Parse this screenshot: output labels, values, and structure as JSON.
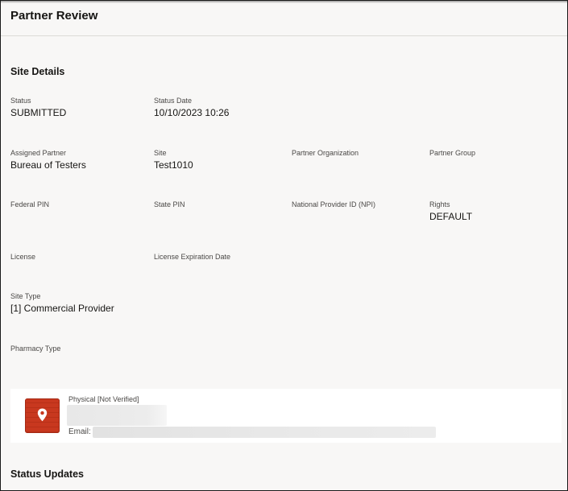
{
  "page": {
    "title": "Partner Review"
  },
  "site_details": {
    "heading": "Site Details",
    "status": {
      "label": "Status",
      "value": "SUBMITTED"
    },
    "status_date": {
      "label": "Status Date",
      "value": "10/10/2023 10:26"
    },
    "assigned_partner": {
      "label": "Assigned Partner",
      "value": "Bureau of Testers"
    },
    "site": {
      "label": "Site",
      "value": "Test1010"
    },
    "partner_organization": {
      "label": "Partner Organization",
      "value": ""
    },
    "partner_group": {
      "label": "Partner Group",
      "value": ""
    },
    "federal_pin": {
      "label": "Federal PIN",
      "value": ""
    },
    "state_pin": {
      "label": "State PIN",
      "value": ""
    },
    "npi": {
      "label": "National Provider ID (NPI)",
      "value": ""
    },
    "rights": {
      "label": "Rights",
      "value": "DEFAULT"
    },
    "license": {
      "label": "License",
      "value": ""
    },
    "license_expiration": {
      "label": "License Expiration Date",
      "value": ""
    },
    "site_type": {
      "label": "Site Type",
      "value": "[1] Commercial Provider"
    },
    "pharmacy_type": {
      "label": "Pharmacy Type",
      "value": ""
    }
  },
  "address": {
    "type_label": "Physical [Not Verified]",
    "email_label": "Email:",
    "icon": "location-pin-icon",
    "icon_color": "#c8381f"
  },
  "status_updates": {
    "heading": "Status Updates"
  }
}
